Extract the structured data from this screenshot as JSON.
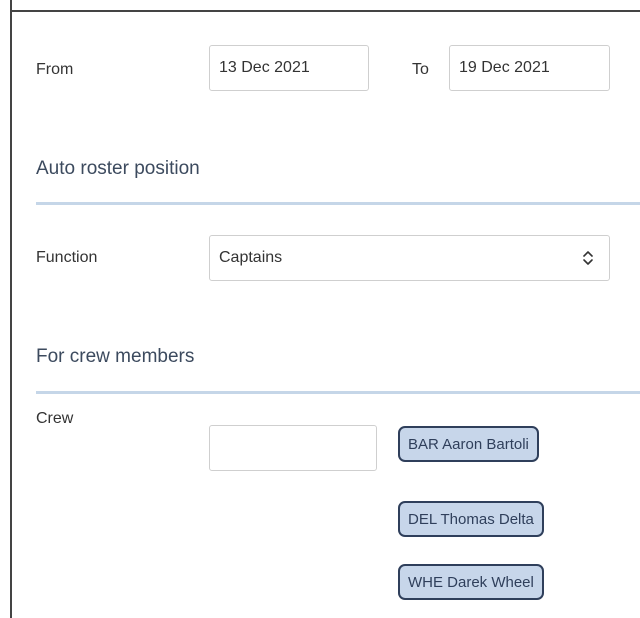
{
  "dates": {
    "from_label": "From",
    "from_value": "13 Dec 2021",
    "to_label": "To",
    "to_value": "19 Dec 2021"
  },
  "auto_roster": {
    "title": "Auto roster position",
    "function_label": "Function",
    "function_value": "Captains",
    "select_icon": "up-down-chevron-icon"
  },
  "crew_section": {
    "title": "For crew members",
    "crew_label": "Crew",
    "crew_input_value": "",
    "selected_crew": [
      "BAR Aaron Bartoli",
      "DEL Thomas Delta",
      "WHE Darek Wheel"
    ]
  }
}
